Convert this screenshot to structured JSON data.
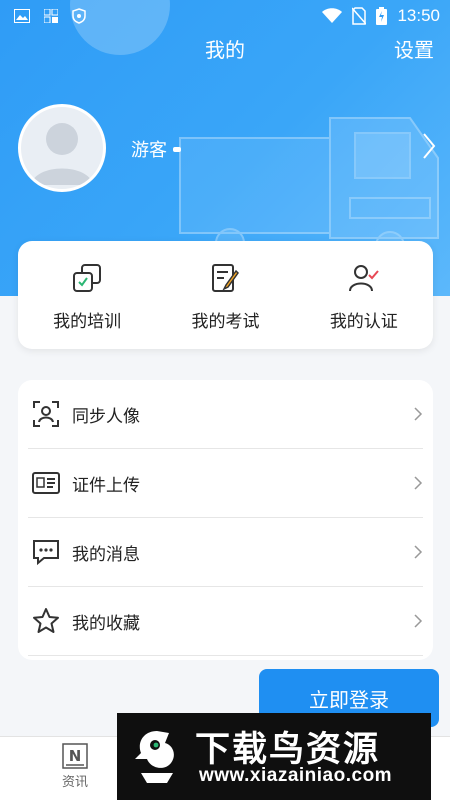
{
  "status_bar": {
    "time": "13:50",
    "icons": [
      "image-icon",
      "grid-icon",
      "shield-icon",
      "wifi-icon",
      "no-sim-icon",
      "battery-charging-icon"
    ]
  },
  "header": {
    "title": "我的",
    "settings_label": "设置"
  },
  "profile": {
    "username": "游客",
    "avatar_icon": "default-avatar-icon"
  },
  "quick_actions": [
    {
      "label": "我的培训",
      "icon": "training-icon"
    },
    {
      "label": "我的考试",
      "icon": "exam-icon"
    },
    {
      "label": "我的认证",
      "icon": "certification-icon"
    }
  ],
  "menu": [
    {
      "label": "同步人像",
      "icon": "face-scan-icon"
    },
    {
      "label": "证件上传",
      "icon": "id-card-icon"
    },
    {
      "label": "我的消息",
      "icon": "message-icon"
    },
    {
      "label": "我的收藏",
      "icon": "star-icon"
    }
  ],
  "login_button": "立即登录",
  "tabbar": {
    "news_label": "资讯",
    "news_icon_glyph": "N"
  },
  "watermark": {
    "title": "下载鸟资源",
    "url": "www.xiazainiao.com"
  },
  "colors": {
    "header_blue": "#2f9cf6",
    "button_blue": "#1f8ff2",
    "accent_red": "#e84855"
  }
}
